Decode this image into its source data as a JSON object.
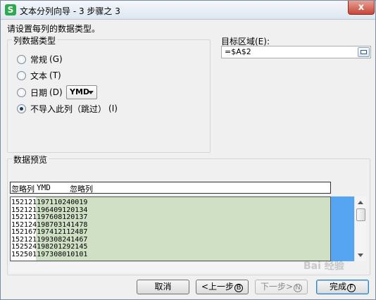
{
  "window": {
    "app_icon_letter": "S",
    "title": "文本分列向导 - 3 步骤之 3",
    "close_symbol": "x"
  },
  "instruction": "请设置每列的数据类型。",
  "column_type": {
    "group_title": "列数据类型",
    "options": [
      {
        "label": "常规",
        "hotkey": "G",
        "checked": false
      },
      {
        "label": "文本",
        "hotkey": "T",
        "checked": false
      },
      {
        "label": "日期",
        "hotkey": "D",
        "checked": false
      },
      {
        "label": "不导入此列（跳过）",
        "hotkey": "I",
        "checked": true
      }
    ],
    "date_format_value": "YMD"
  },
  "target": {
    "label": "目标区域(E):",
    "value": "=$A$2"
  },
  "preview": {
    "group_title": "数据预览",
    "headers": [
      "忽略列",
      "YMD",
      "忽略列"
    ],
    "rows": [
      "152121197110240019",
      "152121196409120134",
      "152121197608120137",
      "152124198703141478",
      "152167197412112487",
      "152121199308241467",
      "152524198201292145",
      "152501197308010101"
    ]
  },
  "buttons": {
    "cancel": "取消",
    "back": "<上一步",
    "back_hotkey": "B",
    "next": "下一步>",
    "next_hotkey": "N",
    "finish": "完成",
    "finish_hotkey": "F"
  },
  "watermark": "Bai 经验"
}
